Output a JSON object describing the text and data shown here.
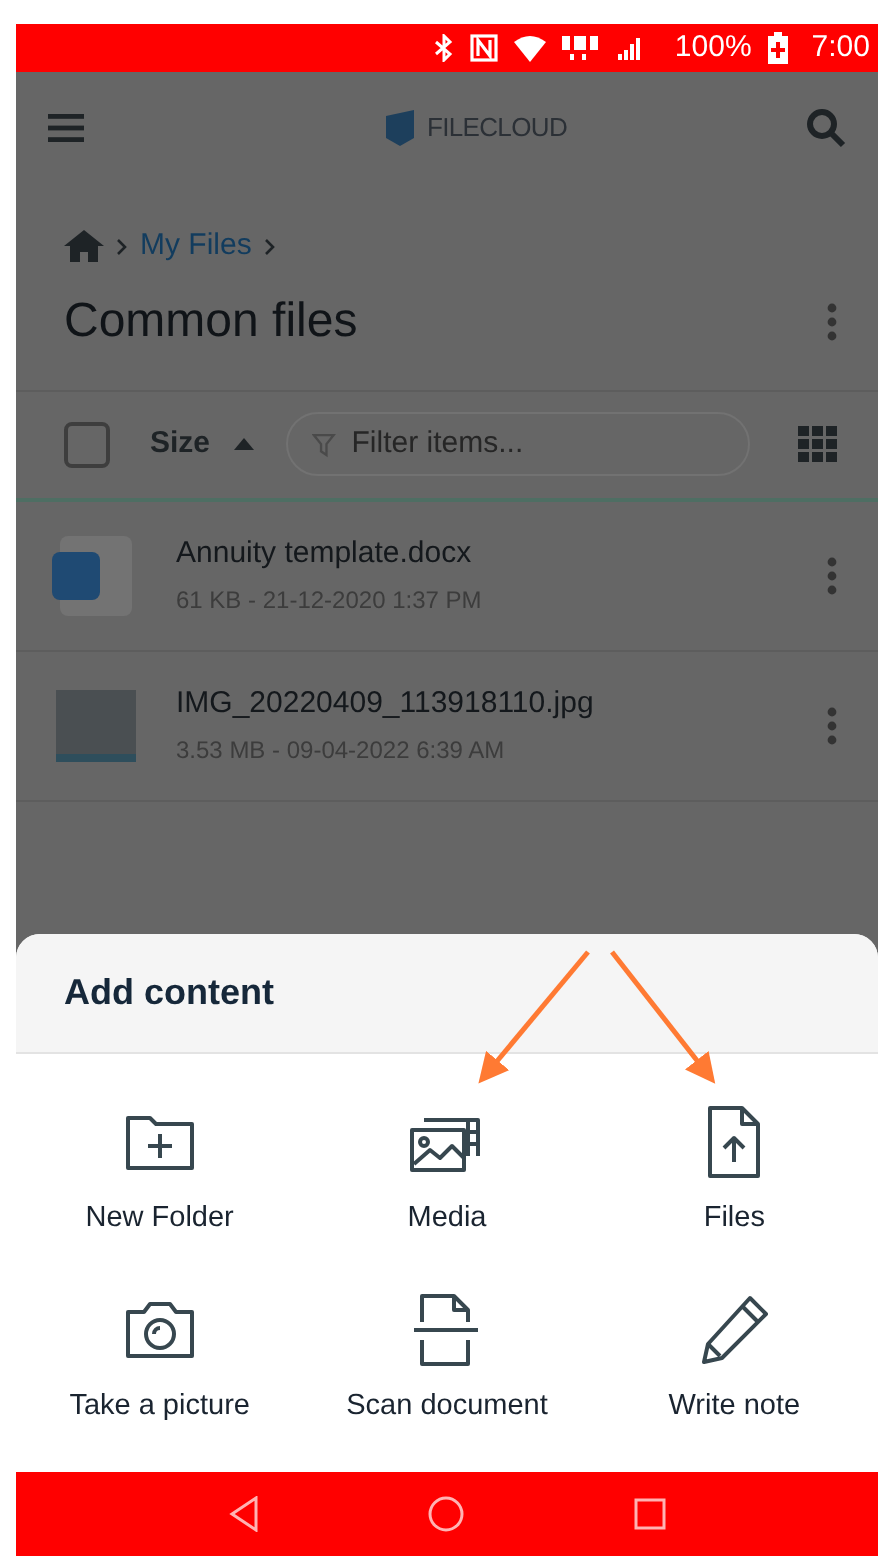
{
  "status_bar": {
    "battery": "100%",
    "time": "7:00"
  },
  "header": {
    "logo": "FILECLOUD"
  },
  "breadcrumb": [
    "My Files"
  ],
  "title": "Common files",
  "toolbar": {
    "select_all": {
      "checked": false
    },
    "sort": "Size",
    "filter": {
      "placeholder": "Filter items..."
    }
  },
  "files": [
    {
      "kind": "docx",
      "name": "Annuity template.docx",
      "meta": "61 KB - 21-12-2020 1:37 PM"
    },
    {
      "kind": "image",
      "name": "IMG_20220409_113918110.jpg",
      "meta": "3.53 MB - 09-04-2022 6:39 AM"
    }
  ],
  "sheet": {
    "title": "Add content",
    "items": [
      {
        "kind": "folder",
        "label": "New Folder"
      },
      {
        "kind": "media",
        "label": "Media"
      },
      {
        "kind": "file",
        "label": "Files"
      },
      {
        "kind": "camera",
        "label": "Take a picture"
      },
      {
        "kind": "scan",
        "label": "Scan document"
      },
      {
        "kind": "note",
        "label": "Write note"
      }
    ]
  }
}
